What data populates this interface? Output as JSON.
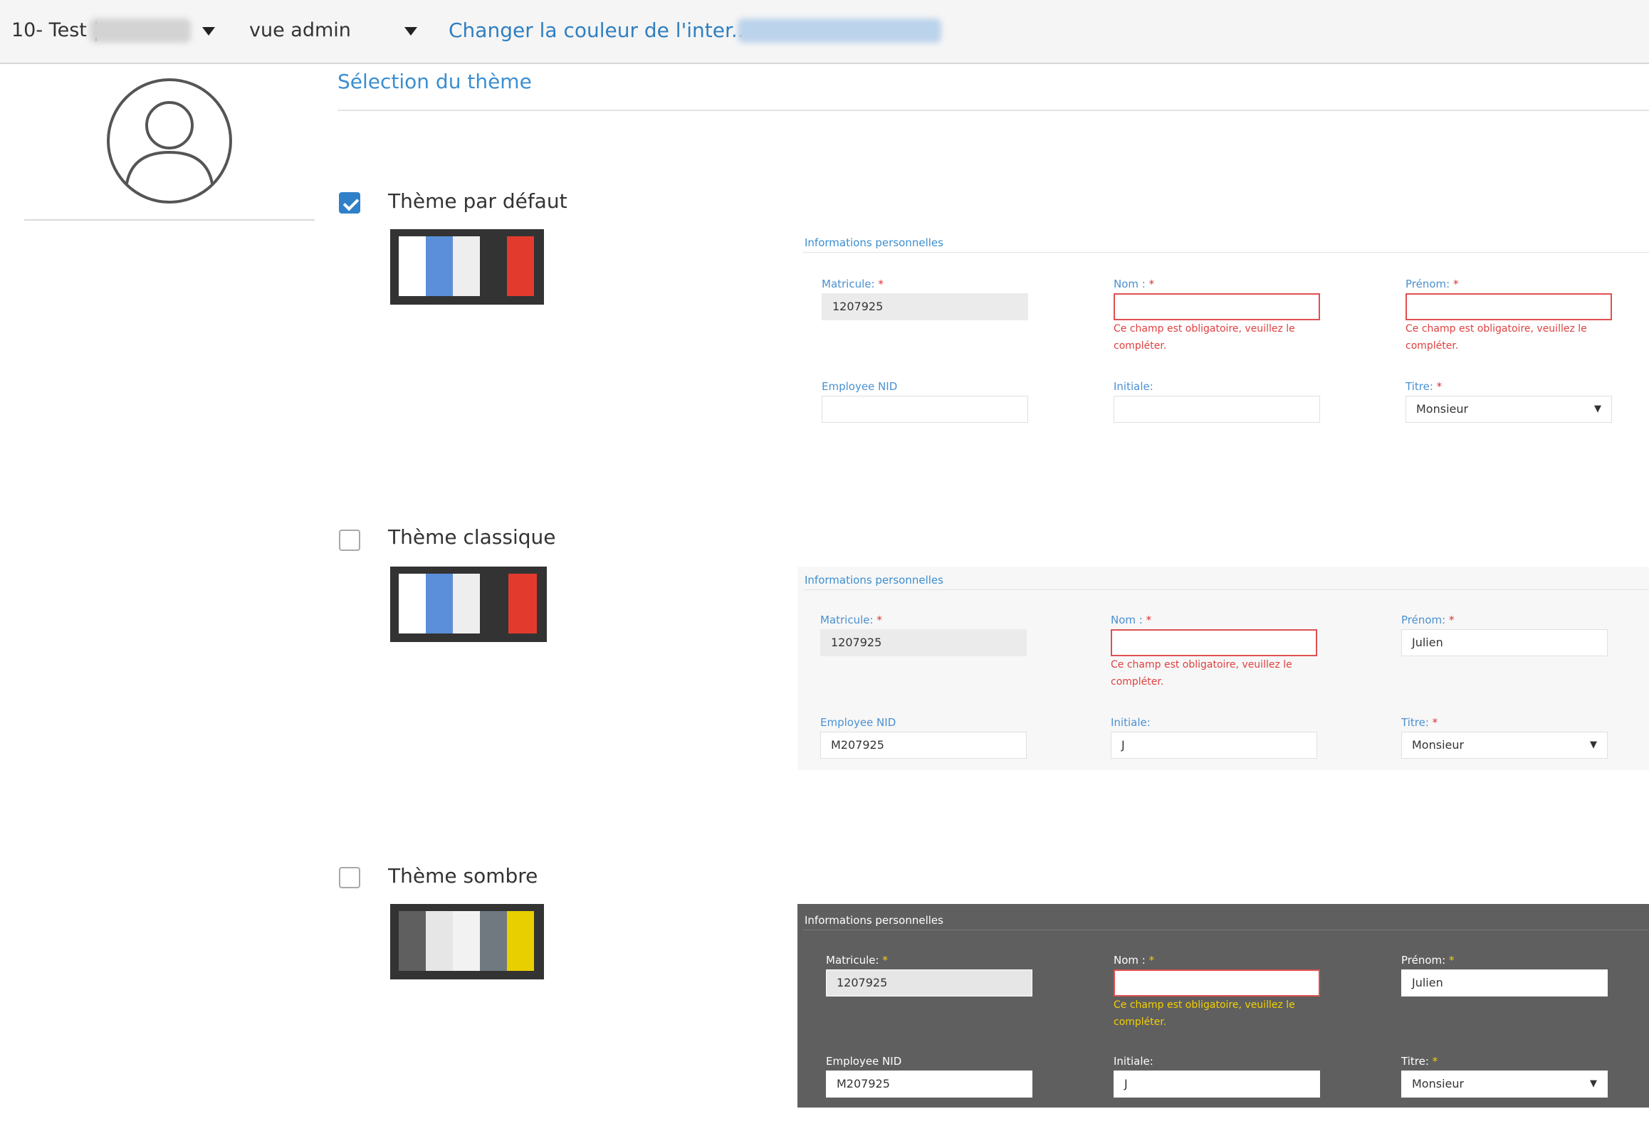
{
  "topbar": {
    "org_label": "10- Test |",
    "view_label": "vue admin",
    "change_color_link": "Changer la couleur de l'inter..."
  },
  "section": {
    "title": "Sélection du thème"
  },
  "themes": [
    {
      "label": "Thème par défaut",
      "checked": true,
      "swatch": [
        "#ffffff",
        "#5b8fd9",
        "#eeeeee",
        "#333333",
        "#e23b2e"
      ]
    },
    {
      "label": "Thème classique",
      "checked": false,
      "swatch": [
        "#ffffff",
        "#5b8fd9",
        "#eeeeee",
        "#333333",
        "#e23b2e"
      ]
    },
    {
      "label": "Thème sombre",
      "checked": false,
      "swatch": [
        "#5f5f5f",
        "#e6e6e6",
        "#f2f2f2",
        "#707880",
        "#e8d000"
      ]
    }
  ],
  "previews": [
    {
      "title": "Informations personnelles",
      "matricule_label": "Matricule:",
      "matricule_value": "1207925",
      "nom_label": "Nom :",
      "nom_value": "",
      "nom_error": "Ce champ est obligatoire, veuillez le compléter.",
      "prenom_label": "Prénom:",
      "prenom_value": "",
      "prenom_error": "Ce champ est obligatoire, veuillez le compléter.",
      "employee_label": "Employee NID",
      "employee_value": "",
      "initiale_label": "Initiale:",
      "initiale_value": "",
      "titre_label": "Titre:",
      "titre_value": "Monsieur",
      "required_mark": "*"
    },
    {
      "title": "Informations personnelles",
      "matricule_label": "Matricule:",
      "matricule_value": "1207925",
      "nom_label": "Nom :",
      "nom_value": "",
      "nom_error": "Ce champ est obligatoire, veuillez le compléter.",
      "prenom_label": "Prénom:",
      "prenom_value": "Julien",
      "employee_label": "Employee NID",
      "employee_value": "M207925",
      "initiale_label": "Initiale:",
      "initiale_value": "J",
      "titre_label": "Titre:",
      "titre_value": "Monsieur",
      "required_mark": "*"
    },
    {
      "title": "Informations personnelles",
      "matricule_label": "Matricule:",
      "matricule_value": "1207925",
      "nom_label": "Nom :",
      "nom_value": "",
      "nom_error": "Ce champ est obligatoire, veuillez le compléter.",
      "prenom_label": "Prénom:",
      "prenom_value": "Julien",
      "employee_label": "Employee NID",
      "employee_value": "M207925",
      "initiale_label": "Initiale:",
      "initiale_value": "J",
      "titre_label": "Titre:",
      "titre_value": "Monsieur",
      "required_mark": "*"
    }
  ],
  "icons": {
    "avatar": "user-circle-icon",
    "caret": "caret-down-icon",
    "select_caret": "▼"
  },
  "colors": {
    "accent": "#3b8ed0",
    "error": "#e04040",
    "dark_error": "#f2d000",
    "checkbox_checked": "#2f80c8"
  }
}
